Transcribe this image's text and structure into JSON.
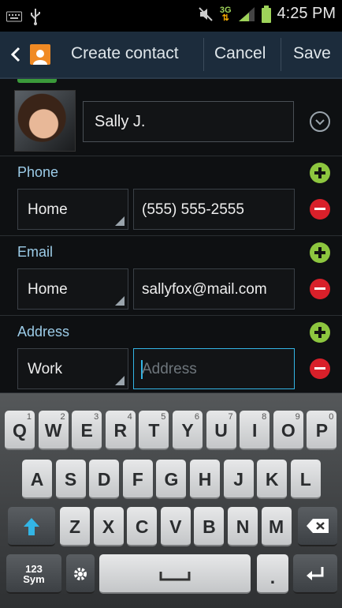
{
  "status_bar": {
    "network": "3G",
    "time": "4:25 PM",
    "icons": [
      "keyboard-icon",
      "usb-icon",
      "mute-icon",
      "signal-icon",
      "battery-icon"
    ]
  },
  "action_bar": {
    "title": "Create contact",
    "cancel_label": "Cancel",
    "save_label": "Save"
  },
  "contact": {
    "name_value": "Sally J."
  },
  "phone": {
    "label": "Phone",
    "type": "Home",
    "value": "(555) 555-2555"
  },
  "email": {
    "label": "Email",
    "type": "Home",
    "value": "sallyfox@mail.com"
  },
  "address": {
    "label": "Address",
    "type": "Work",
    "placeholder": "Address"
  },
  "keyboard": {
    "row1": [
      {
        "main": "Q",
        "sub": "1"
      },
      {
        "main": "W",
        "sub": "2"
      },
      {
        "main": "E",
        "sub": "3"
      },
      {
        "main": "R",
        "sub": "4"
      },
      {
        "main": "T",
        "sub": "5"
      },
      {
        "main": "Y",
        "sub": "6"
      },
      {
        "main": "U",
        "sub": "7"
      },
      {
        "main": "I",
        "sub": "8"
      },
      {
        "main": "O",
        "sub": "9"
      },
      {
        "main": "P",
        "sub": "0"
      }
    ],
    "row2": [
      "A",
      "S",
      "D",
      "F",
      "G",
      "H",
      "J",
      "K",
      "L"
    ],
    "row3": [
      "Z",
      "X",
      "C",
      "V",
      "B",
      "N",
      "M"
    ],
    "sym_label_top": "123",
    "sym_label_bottom": "Sym",
    "period_label": "."
  },
  "colors": {
    "accent": "#33b5e5",
    "add": "#8dc63f",
    "remove": "#d8202a",
    "section_label": "#9ccce8"
  }
}
